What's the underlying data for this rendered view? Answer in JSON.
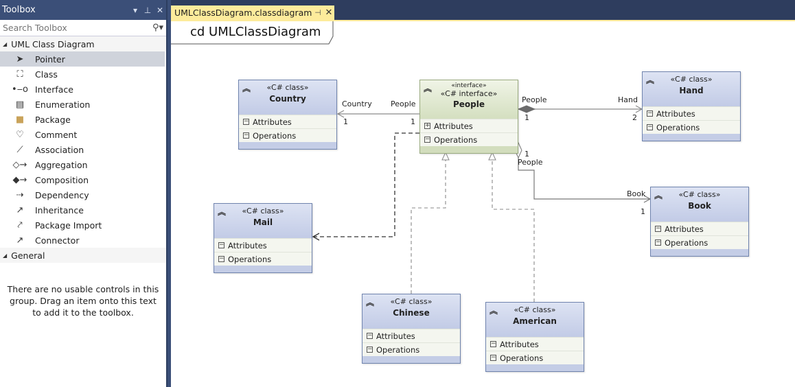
{
  "toolbox": {
    "title": "Toolbox",
    "controls": {
      "dropdown": "▾",
      "pin": "⊥",
      "close": "✕"
    },
    "search_placeholder": "Search Toolbox",
    "search_icon": "search-icon",
    "groups": [
      {
        "label": "UML Class Diagram",
        "items": [
          {
            "label": "Pointer",
            "icon": "pointer-icon",
            "glyph": "➤",
            "selected": true
          },
          {
            "label": "Class",
            "icon": "class-icon",
            "glyph": "⛶"
          },
          {
            "label": "Interface",
            "icon": "interface-icon",
            "glyph": "•‒o"
          },
          {
            "label": "Enumeration",
            "icon": "enumeration-icon",
            "glyph": "▤"
          },
          {
            "label": "Package",
            "icon": "package-icon",
            "glyph": "■"
          },
          {
            "label": "Comment",
            "icon": "comment-icon",
            "glyph": "♡"
          },
          {
            "label": "Association",
            "icon": "association-icon",
            "glyph": "⟋"
          },
          {
            "label": "Aggregation",
            "icon": "aggregation-icon",
            "glyph": "◇→"
          },
          {
            "label": "Composition",
            "icon": "composition-icon",
            "glyph": "◆→"
          },
          {
            "label": "Dependency",
            "icon": "dependency-icon",
            "glyph": "⇢"
          },
          {
            "label": "Inheritance",
            "icon": "inheritance-icon",
            "glyph": "↗"
          },
          {
            "label": "Package Import",
            "icon": "package-import-icon",
            "glyph": "⤤"
          },
          {
            "label": "Connector",
            "icon": "connector-icon",
            "glyph": "↗"
          }
        ]
      },
      {
        "label": "General",
        "items": []
      }
    ],
    "empty_message": "There are no usable controls in this group. Drag an item onto this text to add it to the toolbox."
  },
  "document": {
    "tab_label": "UMLClassDiagram.classdiagram",
    "tab_pin": "⊣",
    "tab_close": "✕",
    "frame_label": "cd UMLClassDiagram"
  },
  "diagram": {
    "classes": [
      {
        "id": "country",
        "stereotype": "«C# class»",
        "name": "Country",
        "compartments": [
          "Attributes",
          "Operations"
        ]
      },
      {
        "id": "people",
        "stereotype_small": "«interface»",
        "stereotype": "«C# interface»",
        "name": "People",
        "compartments": [
          "Attributes",
          "Operations"
        ],
        "attr_expanded": "+"
      },
      {
        "id": "hand",
        "stereotype": "«C# class»",
        "name": "Hand",
        "compartments": [
          "Attributes",
          "Operations"
        ]
      },
      {
        "id": "book",
        "stereotype": "«C# class»",
        "name": "Book",
        "compartments": [
          "Attributes",
          "Operations"
        ]
      },
      {
        "id": "mail",
        "stereotype": "«C# class»",
        "name": "Mail",
        "compartments": [
          "Attributes",
          "Operations"
        ]
      },
      {
        "id": "chinese",
        "stereotype": "«C# class»",
        "name": "Chinese",
        "compartments": [
          "Attributes",
          "Operations"
        ]
      },
      {
        "id": "american",
        "stereotype": "«C# class»",
        "name": "American",
        "compartments": [
          "Attributes",
          "Operations"
        ]
      }
    ],
    "collapse_glyph": "︽",
    "minus_glyph": "−",
    "relationships": [
      {
        "type": "association",
        "from": "People",
        "to": "Country",
        "source_role": "People",
        "target_role": "Country",
        "source_mult": "1",
        "target_mult": "1"
      },
      {
        "type": "composition",
        "from": "People",
        "to": "Hand",
        "source_role": "People",
        "target_role": "Hand",
        "source_mult": "1",
        "target_mult": "2"
      },
      {
        "type": "aggregation",
        "from": "People",
        "to": "Book",
        "source_role": "People",
        "target_role": "Book",
        "source_mult": "1",
        "target_mult": "1"
      },
      {
        "type": "dependency",
        "from": "People",
        "to": "Mail"
      },
      {
        "type": "realization",
        "from": "Chinese",
        "to": "People"
      },
      {
        "type": "realization",
        "from": "American",
        "to": "People"
      }
    ]
  }
}
